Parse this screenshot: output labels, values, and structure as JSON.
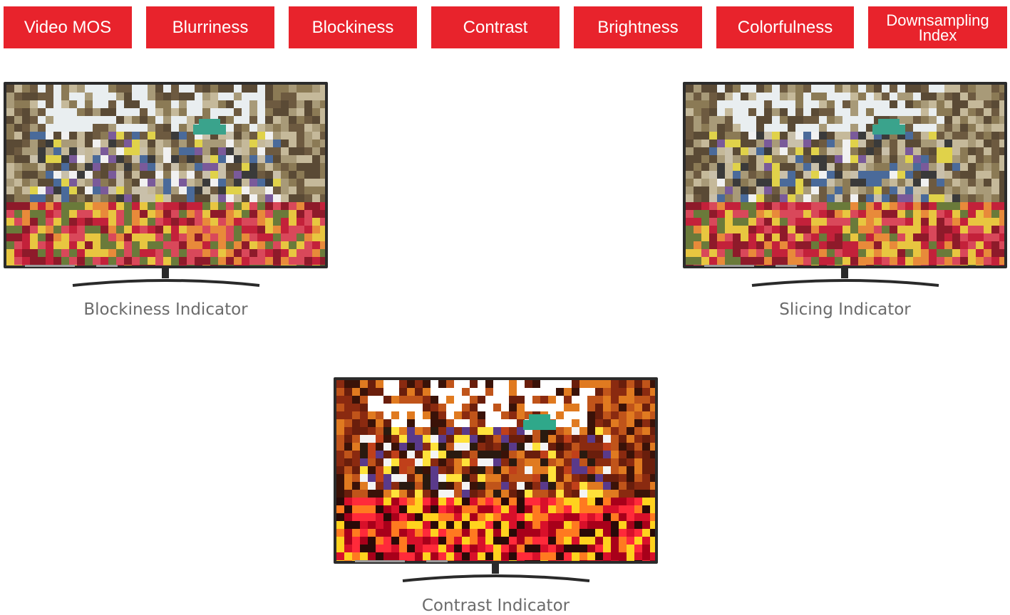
{
  "tabs": [
    {
      "label": "Video MOS"
    },
    {
      "label": "Blurriness"
    },
    {
      "label": "Blockiness"
    },
    {
      "label": "Contrast"
    },
    {
      "label": "Brightness"
    },
    {
      "label": "Colorfulness"
    },
    {
      "label": "Downsampling Index"
    }
  ],
  "colors": {
    "accent": "#e8232c",
    "caption": "#6b6b6b",
    "tv_frame": "#2b2b2b"
  },
  "displays": [
    {
      "caption": "Blockiness Indicator",
      "image": "blocky-tulip-street-scene"
    },
    {
      "caption": "Slicing Indicator",
      "image": "sliced-tulip-street-scene"
    },
    {
      "caption": "Contrast Indicator",
      "image": "high-contrast-tulip-street-scene"
    }
  ]
}
